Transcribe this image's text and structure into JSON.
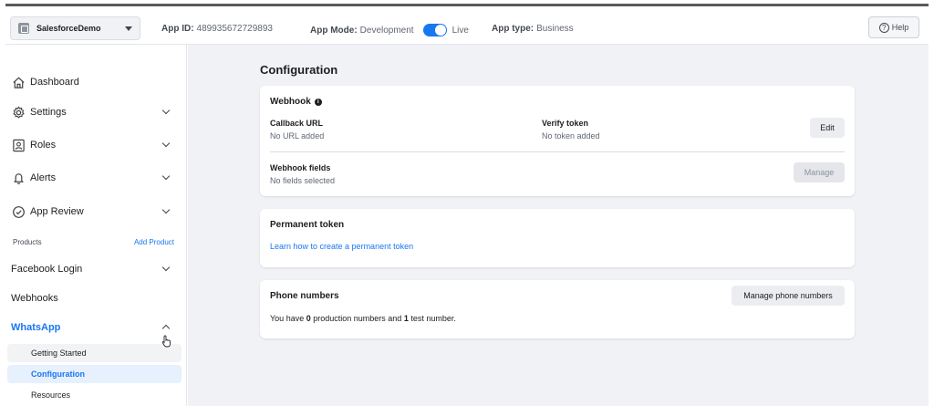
{
  "topbar": {
    "app_name": "SalesforceDemo",
    "app_id_label": "App ID:",
    "app_id_value": "489935672729893",
    "app_mode_label": "App Mode:",
    "app_mode_value": "Development",
    "app_mode_live": "Live",
    "app_type_label": "App type:",
    "app_type_value": "Business",
    "help_label": "Help"
  },
  "sidebar": {
    "items": [
      {
        "label": "Dashboard"
      },
      {
        "label": "Settings"
      },
      {
        "label": "Roles"
      },
      {
        "label": "Alerts"
      },
      {
        "label": "App Review"
      }
    ],
    "products_label": "Products",
    "add_product_label": "Add Product",
    "products": [
      {
        "label": "Facebook Login"
      },
      {
        "label": "Webhooks"
      },
      {
        "label": "WhatsApp"
      }
    ],
    "sub_items": [
      {
        "label": "Getting Started"
      },
      {
        "label": "Configuration"
      },
      {
        "label": "Resources"
      }
    ]
  },
  "main": {
    "title": "Configuration",
    "webhook": {
      "title": "Webhook",
      "callback_label": "Callback URL",
      "callback_value": "No URL added",
      "verify_label": "Verify token",
      "verify_value": "No token added",
      "edit_label": "Edit",
      "fields_label": "Webhook fields",
      "fields_value": "No fields selected",
      "manage_label": "Manage"
    },
    "permanent_token": {
      "title": "Permanent token",
      "link": "Learn how to create a permanent token"
    },
    "phone_numbers": {
      "title": "Phone numbers",
      "button": "Manage phone numbers",
      "text_1": "You have ",
      "production_count": "0",
      "text_2": " production numbers and ",
      "test_count": "1",
      "text_3": " test number."
    }
  },
  "colors": {
    "accent": "#1877f2",
    "background": "#f0f2f5"
  }
}
